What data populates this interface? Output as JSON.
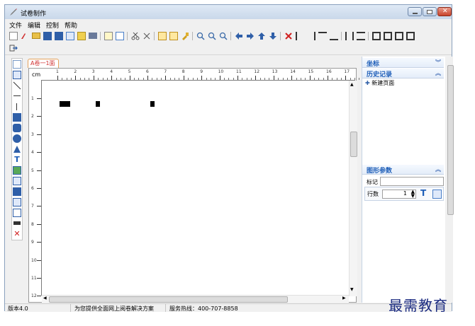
{
  "window": {
    "title": "试卷制作"
  },
  "menu": [
    "文件",
    "编辑",
    "控制",
    "帮助"
  ],
  "tab": {
    "label": "A卷一1面"
  },
  "ruler": {
    "unit": "cm",
    "h_ticks": [
      "1",
      "2",
      "3",
      "4",
      "5",
      "6",
      "7",
      "8",
      "9",
      "10",
      "11",
      "12",
      "13",
      "14",
      "15",
      "16",
      "17"
    ],
    "v_ticks": [
      "1",
      "2",
      "3",
      "4",
      "5",
      "6",
      "7",
      "8",
      "9",
      "10",
      "11",
      "12"
    ]
  },
  "panel": {
    "coord_title": "坐标",
    "history_title": "历史记录",
    "history_item": "新建页面",
    "shape_title": "图形参数",
    "mark_label": "标记",
    "rows_label": "行数",
    "rows_value": "1"
  },
  "status": {
    "version": "版本4.0",
    "slogan": "为您提供全面网上阅卷解决方案",
    "hotline": "服务热线：400-707-8858"
  },
  "watermark": "最需教育",
  "colors": {
    "accent": "#1e5eb8",
    "tab_border": "#e4a25b",
    "tab_text": "#d03030"
  }
}
